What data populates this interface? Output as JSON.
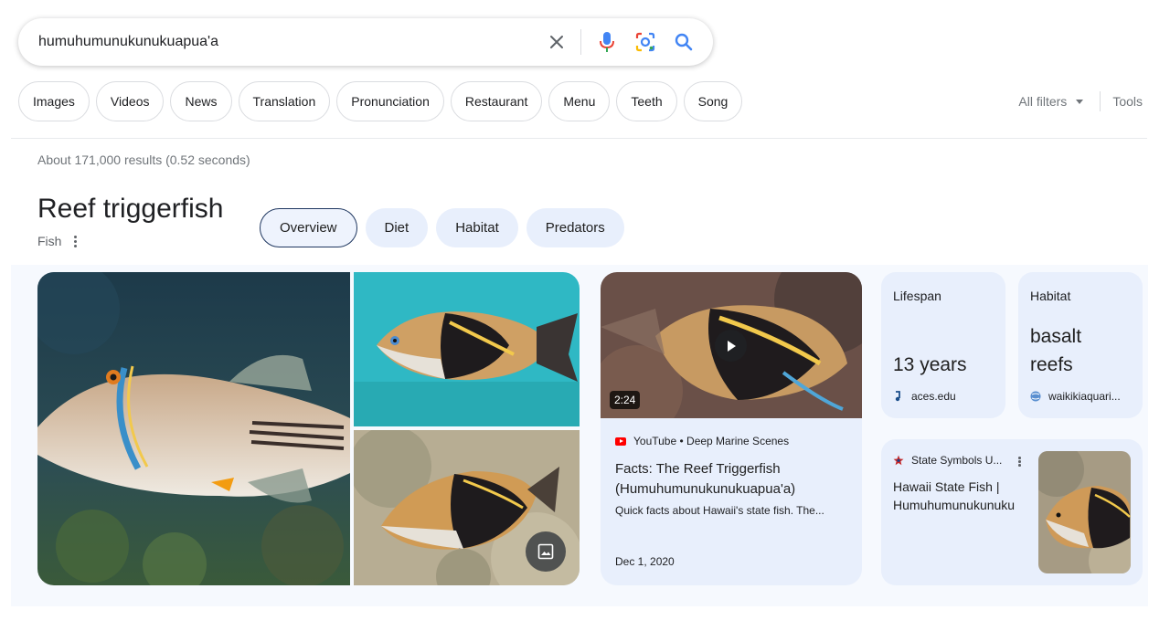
{
  "search": {
    "query": "humuhumunukunukuapua'a"
  },
  "filters": {
    "chips": [
      "Images",
      "Videos",
      "News",
      "Translation",
      "Pronunciation",
      "Restaurant",
      "Menu",
      "Teeth",
      "Song"
    ],
    "all_filters": "All filters",
    "tools": "Tools"
  },
  "result_stats": "About 171,000 results (0.52 seconds)",
  "entity": {
    "title": "Reef triggerfish",
    "subtitle": "Fish",
    "tabs": [
      "Overview",
      "Diet",
      "Habitat",
      "Predators"
    ]
  },
  "video": {
    "duration": "2:24",
    "source": "YouTube • Deep Marine Scenes",
    "title": "Facts: The Reef Triggerfish (Humuhumunukunukuapua'a)",
    "description": "Quick facts about Hawaii's state fish. The...",
    "date": "Dec 1, 2020"
  },
  "facts": {
    "lifespan": {
      "label": "Lifespan",
      "value": "13 years",
      "source": "aces.edu"
    },
    "habitat": {
      "label": "Habitat",
      "value_line1": "basalt",
      "value_line2": "reefs",
      "source": "waikikiaquari..."
    }
  },
  "state_card": {
    "source": "State Symbols U...",
    "title_line1": "Hawaii State Fish |",
    "title_line2": "Humuhumunukunuku"
  },
  "colors": {
    "accent_blue": "#1a73e8",
    "card_bg": "#e8effc",
    "youtube_red": "#ff0000"
  }
}
